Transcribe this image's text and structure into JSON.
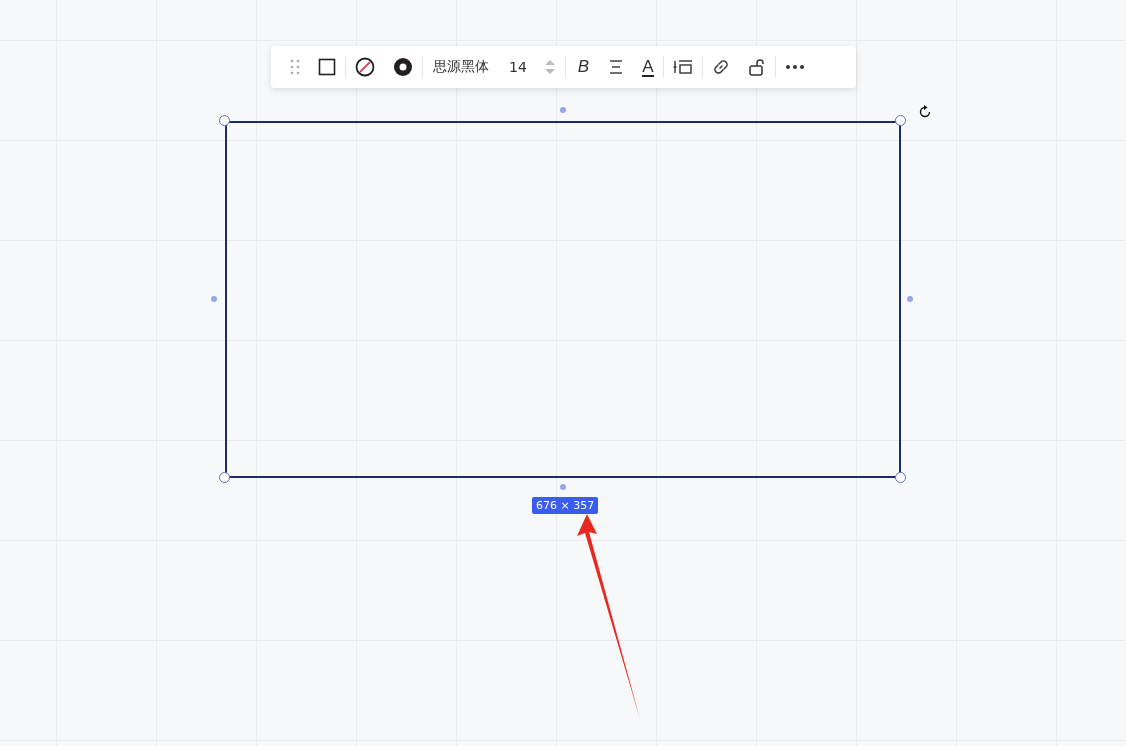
{
  "toolbar": {
    "font": "思源黑体",
    "font_size": "14",
    "bold": "B",
    "text_color": "A"
  },
  "shape": {
    "size_label": "676 × 357"
  }
}
